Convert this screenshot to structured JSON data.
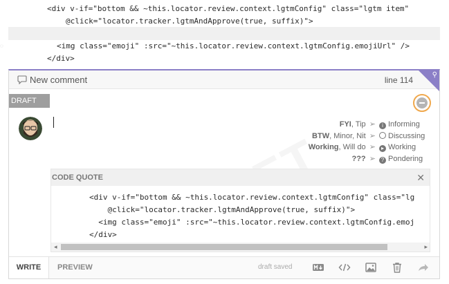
{
  "context_code": {
    "line1": "<div v-if=\"bottom && ~this.locator.review.context.lgtmConfig\" class=\"lgtm item\"",
    "line2": "@click=\"locator.tracker.lgtmAndApprove(true, suffix)\">",
    "line3": "<img class=\"emoji\" :src=\"~this.locator.review.context.lgtmConfig.emojiUrl\" />",
    "line4": "</div>"
  },
  "comment": {
    "title": "New comment",
    "line_ref": "line 114",
    "draft_label": "DRAFT",
    "watermark": "DRAFT",
    "accent_color": "#8b7fc7",
    "draft_flag_color": "#9e9e9e",
    "discard_ring_color": "#f0a84c"
  },
  "legend": [
    {
      "keywords": "FYI",
      "rest": ", Tip",
      "icon": "info-circle-icon",
      "label": "Informing"
    },
    {
      "keywords": "BTW",
      "rest": ", Minor, Nit",
      "icon": "circle-outline-icon",
      "label": "Discussing"
    },
    {
      "keywords": "Working",
      "rest": ", Will do",
      "icon": "play-circle-icon",
      "label": "Working"
    },
    {
      "keywords": "???",
      "rest": "",
      "icon": "question-circle-icon",
      "label": "Pondering"
    }
  ],
  "quote": {
    "header": "CODE QUOTE",
    "close": "✕",
    "lines": [
      "<div v-if=\"bottom && ~this.locator.review.context.lgtmConfig\" class=\"lg",
      "    @click=\"locator.tracker.lgtmAndApprove(true, suffix)\">",
      "  <img class=\"emoji\" :src=\"~this.locator.review.context.lgtmConfig.emoj",
      "</div>"
    ]
  },
  "footer": {
    "write_tab": "WRITE",
    "preview_tab": "PREVIEW",
    "status": "draft saved",
    "icons": [
      "markdown-icon",
      "code-icon",
      "image-icon",
      "trash-icon",
      "send-arrow-icon"
    ]
  }
}
